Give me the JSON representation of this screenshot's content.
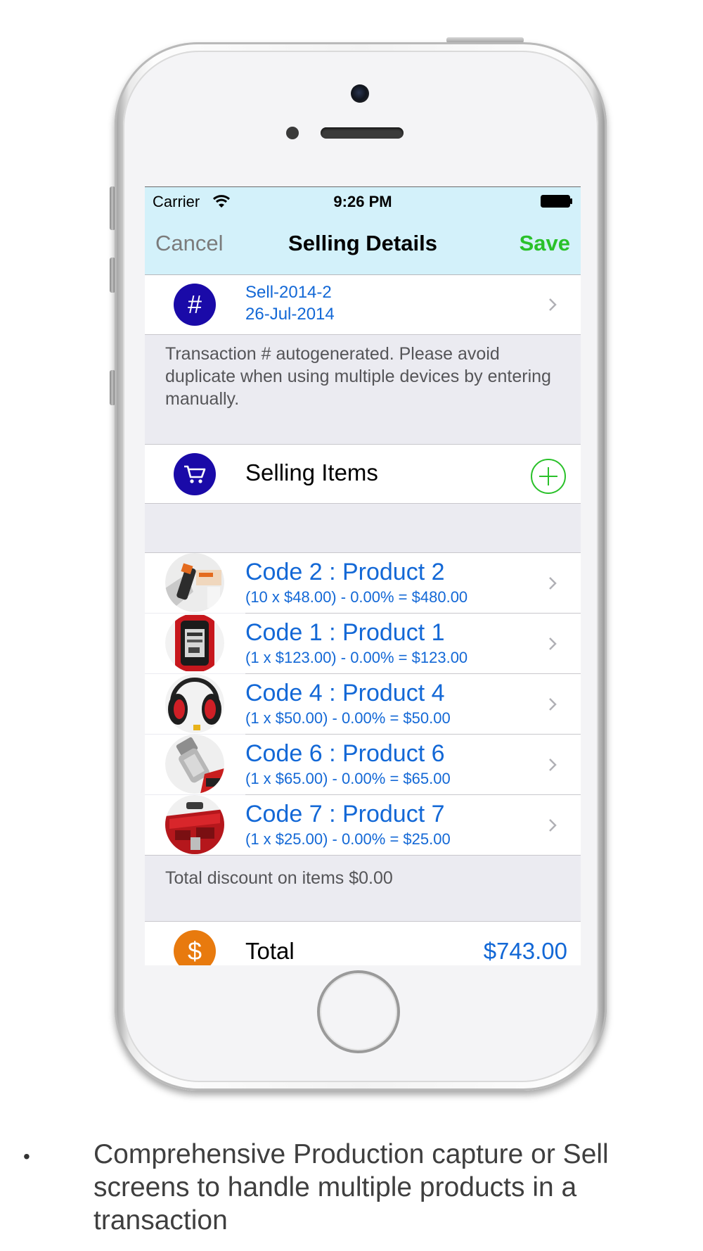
{
  "status_bar": {
    "carrier": "Carrier",
    "time": "9:26 PM"
  },
  "nav": {
    "cancel_label": "Cancel",
    "title": "Selling Details",
    "save_label": "Save",
    "background_color": "#d3f1fa",
    "save_color": "#2ac12a"
  },
  "transaction": {
    "icon": "hash-icon",
    "icon_glyph": "#",
    "number": "Sell-2014-2",
    "date": "26-Jul-2014",
    "note": "Transaction # autogenerated. Please avoid duplicate when using multiple devices by entering manually."
  },
  "selling_items": {
    "icon": "shopping-cart-icon",
    "label": "Selling Items",
    "add_icon": "plus-circle-icon",
    "icon_color": "#1a0aa8"
  },
  "items": [
    {
      "title": "Code 2 : Product 2",
      "detail": "(10 x $48.00) - 0.00% = $480.00",
      "thumb": "cleaner-product"
    },
    {
      "title": "Code 1 : Product 1",
      "detail": "(1 x $123.00) - 0.00% = $123.00",
      "thumb": "smartwatch"
    },
    {
      "title": "Code 4 : Product 4",
      "detail": "(1 x $50.00) - 0.00% = $50.00",
      "thumb": "ear-muffs"
    },
    {
      "title": "Code 6 : Product 6",
      "detail": "(1 x $65.00) - 0.00% = $65.00",
      "thumb": "spray-nozzle"
    },
    {
      "title": "Code 7 : Product 7",
      "detail": "(1 x $25.00) - 0.00% = $25.00",
      "thumb": "red-toolbox"
    }
  ],
  "discount_note": "Total discount on items $0.00",
  "total": {
    "icon": "dollar-icon",
    "icon_glyph": "$",
    "label": "Total",
    "value": "$743.00",
    "icon_color": "#e87a0e"
  },
  "caption": {
    "bullet": "•",
    "text": "Comprehensive Production capture or Sell screens to handle multiple products in a transaction"
  },
  "colors": {
    "link_blue": "#1368d6",
    "group_background": "#ebebf1"
  }
}
